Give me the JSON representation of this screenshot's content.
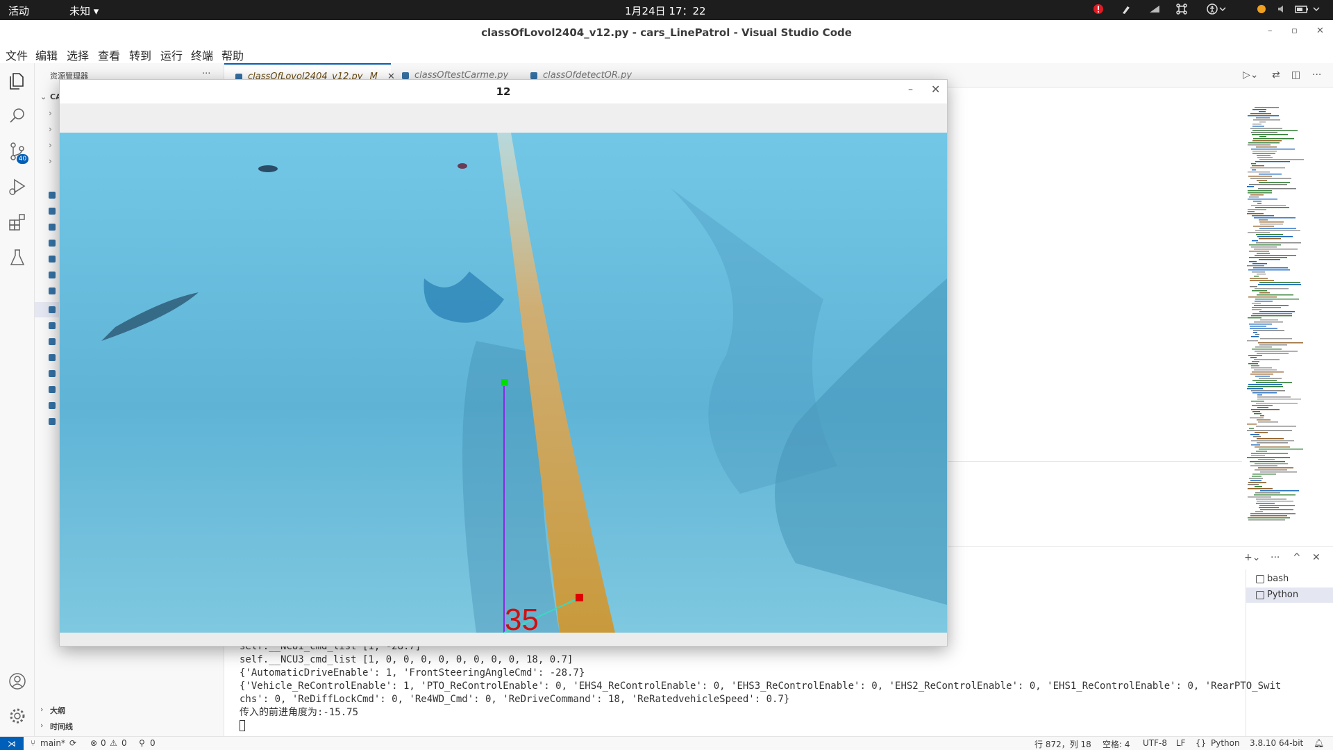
{
  "topbar": {
    "activities": "活动",
    "app_menu": "未知 ▾",
    "clock": "1月24日  17：22"
  },
  "window": {
    "title": "classOfLovol2404_v12.py - cars_LinePatrol - Visual Studio Code"
  },
  "menu": [
    "文件",
    "编辑",
    "选择",
    "查看",
    "转到",
    "运行",
    "终端",
    "帮助"
  ],
  "activity_bar": {
    "scm_badge": "40"
  },
  "explorer": {
    "title": "资源管理器",
    "more": "···",
    "workspace_label": "CA",
    "outline": "大纲",
    "timeline": "时间线"
  },
  "tabs": [
    {
      "label": "classOfLovol2404_v12.py",
      "status": "M"
    },
    {
      "label": "classOftestCarme.py"
    },
    {
      "label": "classOfdetectOR.py"
    }
  ],
  "terminal": {
    "tabs": [
      "bash",
      "Python"
    ],
    "lines": [
      "self.__NCU1_cmd_list [1, -28.7]",
      "self.__NCU3_cmd_list [1, 0, 0, 0, 0, 0, 0, 0, 0, 18, 0.7]",
      "{'AutomaticDriveEnable': 1, 'FrontSteeringAngleCmd': -28.7}",
      "{'Vehicle_ReControlEnable': 1, 'PTO_ReControlEnable': 0, 'EHS4_ReControlEnable': 0, 'EHS3_ReControlEnable': 0, 'EHS2_ReControlEnable': 0, 'EHS1_ReControlEnable': 0, 'RearPTO_Swit",
      "chs': 0, 'ReDiffLockCmd': 0, 'Re4WD_Cmd': 0, 'ReDriveCommand': 18, 'ReRatedvehicleSpeed': 0.7}",
      "传入的前进角度为:-15.75"
    ]
  },
  "statusbar": {
    "branch": "main*",
    "errors": "0",
    "warnings": "0",
    "ports": "0",
    "position": "行 872，列 18",
    "spaces": "空格: 4",
    "encoding": "UTF-8",
    "eol": "LF",
    "language": "Python",
    "interpreter": "3.8.10 64-bit"
  },
  "cv_window": {
    "title": "12",
    "overlay_number": "35"
  },
  "colors": {
    "accent": "#005fb8",
    "lane_yellow": "#c9a24a",
    "ground": "#5fb6d9",
    "marker_green": "#00e000",
    "marker_red": "#e00000",
    "line_purple": "#8a2be2",
    "overlay_text": "#d01010"
  }
}
